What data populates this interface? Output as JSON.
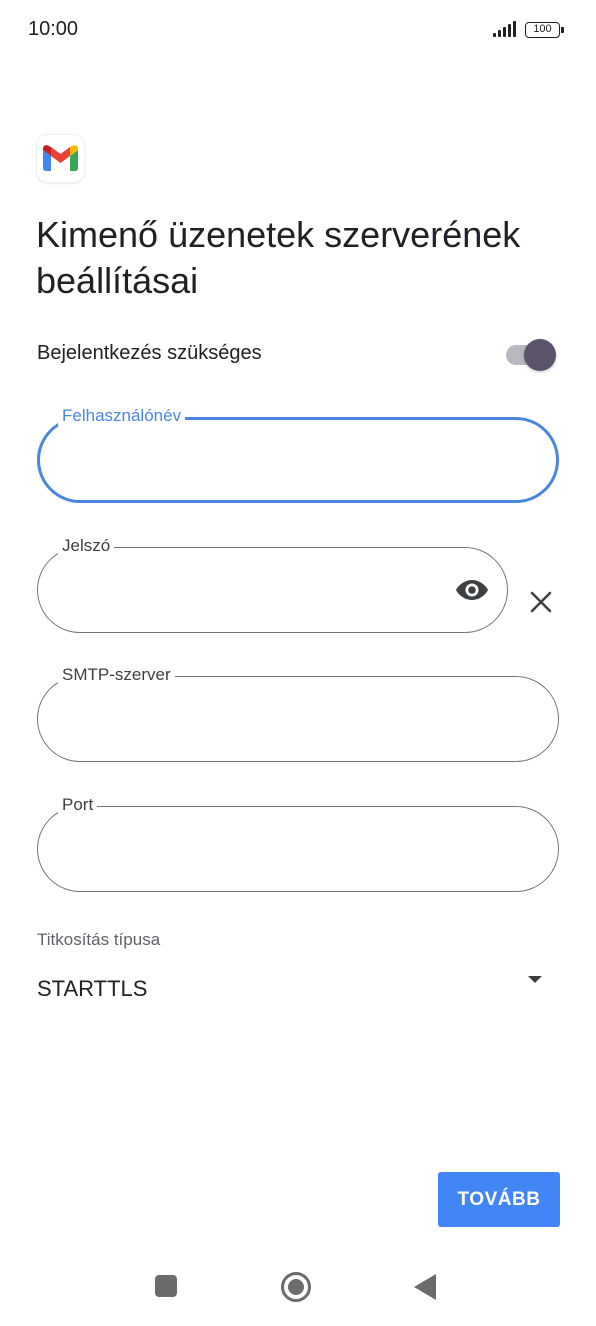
{
  "status_bar": {
    "time": "10:00",
    "battery": "100",
    "signal_icon": "signal-bars-icon",
    "battery_icon": "battery-icon"
  },
  "app": {
    "logo_icon": "gmail-icon",
    "title": "Kimenő üzenetek szerverének beállításai"
  },
  "login_required": {
    "label": "Bejelentkezés szükséges",
    "enabled": true
  },
  "fields": {
    "username": {
      "label": "Felhasználónév",
      "value": ""
    },
    "password": {
      "label": "Jelszó",
      "value": "",
      "reveal_icon": "eye-icon",
      "clear_icon": "close-icon"
    },
    "smtp_server": {
      "label": "SMTP-szerver",
      "value": ""
    },
    "port": {
      "label": "Port",
      "value": ""
    }
  },
  "encryption": {
    "label": "Titkosítás típusa",
    "selected": "STARTTLS"
  },
  "actions": {
    "next_label": "TOVÁBB"
  },
  "nav_bar": {
    "recents_icon": "square-icon",
    "home_icon": "circle-home-icon",
    "back_icon": "triangle-back-icon"
  },
  "colors": {
    "accent": "#4285f4",
    "focused_border": "#4a86e0",
    "toggle_thumb": "#5b526b",
    "toggle_track": "#b9b7bf"
  }
}
